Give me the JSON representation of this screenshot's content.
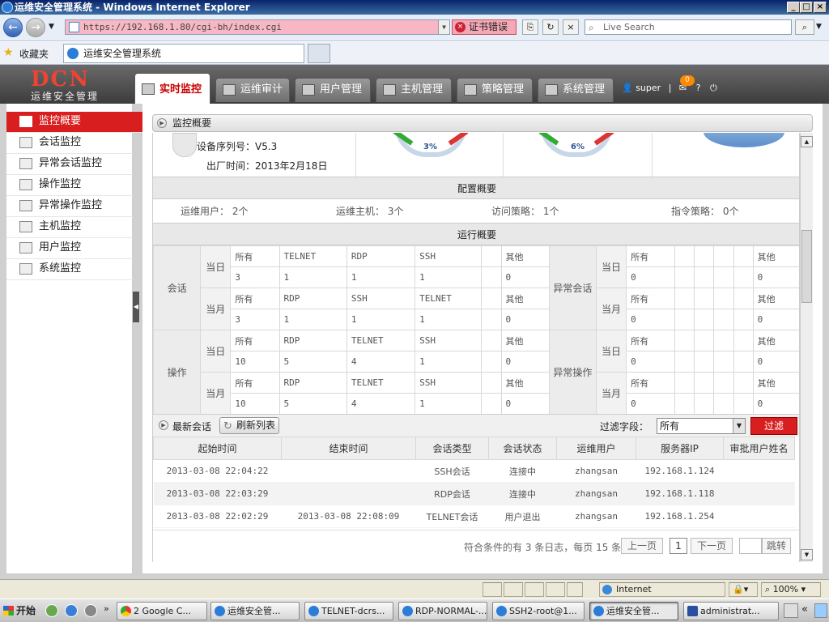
{
  "window": {
    "title": "运维安全管理系统 - Windows Internet Explorer"
  },
  "browser": {
    "url": "https://192.168.1.80/cgi-bh/index.cgi",
    "cert_error": "证书错误",
    "search_placeholder": "Live Search",
    "favorites": "收藏夹",
    "tab_title": "运维安全管理系统"
  },
  "app": {
    "logo_text": "DCN",
    "logo_sub": "运维安全管理",
    "tabs": [
      "实时监控",
      "运维审计",
      "用户管理",
      "主机管理",
      "策略管理",
      "系统管理"
    ],
    "user": "super",
    "badge": "0"
  },
  "sidebar": {
    "items": [
      "监控概要",
      "会话监控",
      "异常会话监控",
      "操作监控",
      "异常操作监控",
      "主机监控",
      "用户监控",
      "系统监控"
    ]
  },
  "crumb": "监控概要",
  "device": {
    "serial": "设备序列号：V5.3",
    "factory": "出厂时间：2013年2月18日",
    "gauge1": "3%",
    "gauge2": "6%"
  },
  "config": {
    "title": "配置概要",
    "users": "运维用户： 2个",
    "hosts": "运维主机： 3个",
    "access": "访问策略： 1个",
    "command": "指令策略： 0个"
  },
  "run": {
    "title": "运行概要",
    "session": "会话",
    "operation": "操作",
    "abn_session": "异常会话",
    "abn_operation": "异常操作",
    "today": "当日",
    "month": "当月",
    "rows": [
      {
        "h": [
          "所有",
          "TELNET",
          "RDP",
          "SSH",
          "",
          "其他"
        ],
        "v": [
          "3",
          "1",
          "1",
          "1",
          "",
          "0"
        ]
      },
      {
        "h": [
          "所有",
          "RDP",
          "SSH",
          "TELNET",
          "",
          "其他"
        ],
        "v": [
          "3",
          "1",
          "1",
          "1",
          "",
          "0"
        ]
      },
      {
        "h": [
          "所有",
          "RDP",
          "TELNET",
          "SSH",
          "",
          "其他"
        ],
        "v": [
          "10",
          "5",
          "4",
          "1",
          "",
          "0"
        ]
      },
      {
        "h": [
          "所有",
          "RDP",
          "TELNET",
          "SSH",
          "",
          "其他"
        ],
        "v": [
          "10",
          "5",
          "4",
          "1",
          "",
          "0"
        ]
      }
    ],
    "abn": {
      "h": [
        "所有",
        "",
        "",
        "",
        "",
        "其他"
      ],
      "v": [
        "0",
        "",
        "",
        "",
        "",
        "0"
      ]
    }
  },
  "latest": {
    "title": "最新会话",
    "refresh": "刷新列表",
    "filter_label": "过滤字段：",
    "filter_value": "所有",
    "filter_btn": "过滤",
    "columns": [
      "起始时间",
      "结束时间",
      "会话类型",
      "会话状态",
      "运维用户",
      "服务器IP",
      "审批用户姓名"
    ],
    "rows": [
      [
        "2013-03-08 22:04:22",
        "",
        "SSH会话",
        "连接中",
        "zhangsan",
        "192.168.1.124",
        ""
      ],
      [
        "2013-03-08 22:03:29",
        "",
        "RDP会话",
        "连接中",
        "zhangsan",
        "192.168.1.118",
        ""
      ],
      [
        "2013-03-08 22:02:29",
        "2013-03-08 22:08:09",
        "TELNET会话",
        "用户退出",
        "zhangsan",
        "192.168.1.254",
        ""
      ]
    ]
  },
  "pager": {
    "info": "符合条件的有 3 条日志，每页 15 条",
    "prev": "上一页",
    "page": "1",
    "next": "下一页",
    "jump": "跳转"
  },
  "status": {
    "zone": "Internet",
    "zoom": "100%"
  },
  "taskbar": {
    "start": "开始",
    "items": [
      "2 Google C...",
      "运维安全管...",
      "TELNET-dcrs...",
      "RDP-NORMAL-...",
      "SSH2-root@1...",
      "运维安全管...",
      "administrat..."
    ],
    "clock": "«"
  },
  "colors": {
    "accent": "#d81e1e",
    "header": "#3c3c3c",
    "ie_title": "#0a246a"
  }
}
